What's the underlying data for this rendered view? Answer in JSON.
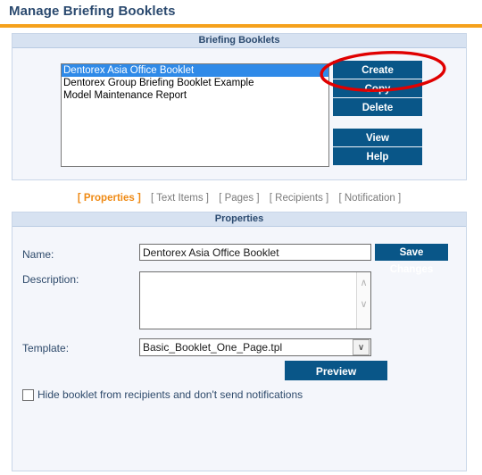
{
  "page": {
    "title": "Manage Briefing Booklets",
    "accent_orange": "#f5a11c",
    "accent_blue": "#095688",
    "annotation_color": "#e00000"
  },
  "booklets_panel": {
    "header": "Briefing Booklets",
    "list": {
      "items": [
        {
          "label": "Dentorex Asia Office Booklet",
          "selected": true
        },
        {
          "label": "Dentorex Group Briefing Booklet Example",
          "selected": false
        },
        {
          "label": "Model Maintenance Report",
          "selected": false
        }
      ]
    },
    "buttons": {
      "create": "Create",
      "copy": "Copy",
      "delete": "Delete",
      "view": "View",
      "help": "Help"
    },
    "annotation": {
      "shape": "ellipse",
      "targets": "create-button"
    }
  },
  "tabs": [
    {
      "label": "[ Properties ]",
      "active": true
    },
    {
      "label": "[ Text Items ]",
      "active": false
    },
    {
      "label": "[ Pages ]",
      "active": false
    },
    {
      "label": "[ Recipients ]",
      "active": false
    },
    {
      "label": "[ Notification ]",
      "active": false
    }
  ],
  "properties_panel": {
    "header": "Properties",
    "name": {
      "label": "Name:",
      "value": "Dentorex Asia Office Booklet",
      "placeholder": ""
    },
    "save_changes_label": "Save Changes",
    "description": {
      "label": "Description:",
      "value": "",
      "placeholder": ""
    },
    "template": {
      "label": "Template:",
      "value": "Basic_Booklet_One_Page.tpl",
      "options": [
        "Basic_Booklet_One_Page.tpl"
      ]
    },
    "preview_label": "Preview",
    "hide_checkbox": {
      "label": "Hide booklet from recipients and don't send notifications",
      "checked": false
    }
  },
  "icons": {
    "scroll_up": "∧",
    "scroll_down": "∨",
    "chevron_down": "∨"
  }
}
